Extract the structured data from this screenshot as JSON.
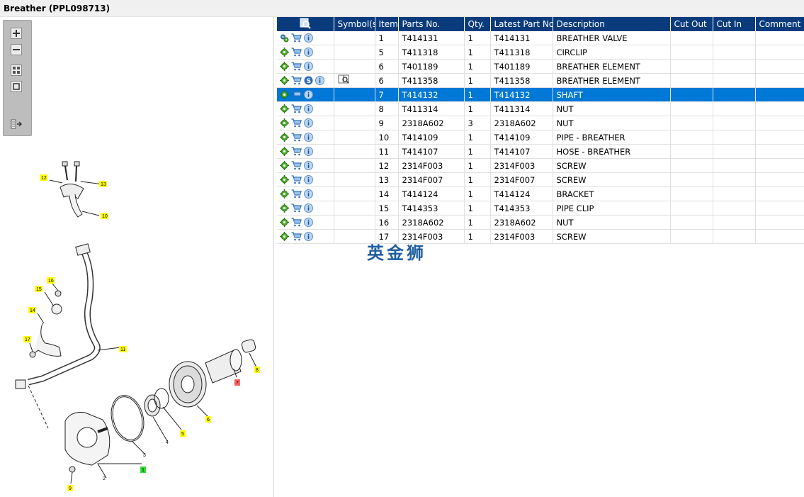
{
  "title": "Breather (PPL098713)",
  "colors": {
    "header_bg": "#0a3c7d",
    "selected_row": "#0078d7",
    "callout_yellow": "#ffff00",
    "callout_red": "#ff6060",
    "callout_green": "#33dd33"
  },
  "toolbar": {
    "buttons": [
      {
        "name": "zoom-in",
        "icon": "plus-icon"
      },
      {
        "name": "zoom-out",
        "icon": "minus-icon"
      },
      {
        "name": "fit",
        "icon": "fit-all-icon"
      },
      {
        "name": "actual-size",
        "icon": "square-icon"
      },
      {
        "name": "toggle-panel",
        "icon": "list-arrow-icon"
      }
    ]
  },
  "table": {
    "headers": {
      "search": "",
      "symbols": "Symbol(s)",
      "item": "Item",
      "parts_no": "Parts No.",
      "qty": "Qty.",
      "latest_part_no": "Latest Part No.",
      "description": "Description",
      "cut_out": "Cut Out",
      "cut_in": "Cut In",
      "comment": "Comment"
    },
    "rows": [
      {
        "item": "1",
        "parts_no": "T414131",
        "qty": "1",
        "latest": "T414131",
        "description": "BREATHER VALVE",
        "cut_out": "",
        "cut_in": "",
        "comment": "",
        "icons": [
          "gears-icon",
          "cart-icon",
          "info-icon"
        ],
        "symbol": ""
      },
      {
        "item": "5",
        "parts_no": "T411318",
        "qty": "1",
        "latest": "T411318",
        "description": "CIRCLIP",
        "cut_out": "",
        "cut_in": "",
        "comment": "",
        "icons": [
          "gear-icon",
          "cart-icon",
          "info-icon"
        ],
        "symbol": ""
      },
      {
        "item": "6",
        "parts_no": "T401189",
        "qty": "1",
        "latest": "T401189",
        "description": "BREATHER ELEMENT",
        "cut_out": "",
        "cut_in": "",
        "comment": "",
        "icons": [
          "gear-icon",
          "cart-icon",
          "info-icon"
        ],
        "symbol": ""
      },
      {
        "item": "6",
        "parts_no": "T411358",
        "qty": "1",
        "latest": "T411358",
        "description": "BREATHER ELEMENT",
        "cut_out": "",
        "cut_in": "",
        "comment": "",
        "icons": [
          "gear-icon",
          "cart-icon",
          "s-icon",
          "info-icon"
        ],
        "symbol": "book-search-icon"
      },
      {
        "item": "7",
        "parts_no": "T414132",
        "qty": "1",
        "latest": "T414132",
        "description": "SHAFT",
        "cut_out": "",
        "cut_in": "",
        "comment": "",
        "icons": [
          "gear-icon",
          "cart-icon",
          "info-icon"
        ],
        "symbol": "",
        "selected": true
      },
      {
        "item": "8",
        "parts_no": "T411314",
        "qty": "1",
        "latest": "T411314",
        "description": "NUT",
        "cut_out": "",
        "cut_in": "",
        "comment": "",
        "icons": [
          "gear-icon",
          "cart-icon",
          "info-icon"
        ],
        "symbol": ""
      },
      {
        "item": "9",
        "parts_no": "2318A602",
        "qty": "3",
        "latest": "2318A602",
        "description": "NUT",
        "cut_out": "",
        "cut_in": "",
        "comment": "",
        "icons": [
          "gear-icon",
          "cart-icon",
          "info-icon"
        ],
        "symbol": ""
      },
      {
        "item": "10",
        "parts_no": "T414109",
        "qty": "1",
        "latest": "T414109",
        "description": "PIPE - BREATHER",
        "cut_out": "",
        "cut_in": "",
        "comment": "",
        "icons": [
          "gear-icon",
          "cart-icon",
          "info-icon"
        ],
        "symbol": ""
      },
      {
        "item": "11",
        "parts_no": "T414107",
        "qty": "1",
        "latest": "T414107",
        "description": "HOSE - BREATHER",
        "cut_out": "",
        "cut_in": "",
        "comment": "",
        "icons": [
          "gear-icon",
          "cart-icon",
          "info-icon"
        ],
        "symbol": ""
      },
      {
        "item": "12",
        "parts_no": "2314F003",
        "qty": "1",
        "latest": "2314F003",
        "description": "SCREW",
        "cut_out": "",
        "cut_in": "",
        "comment": "",
        "icons": [
          "gear-icon",
          "cart-icon",
          "info-icon"
        ],
        "symbol": ""
      },
      {
        "item": "13",
        "parts_no": "2314F007",
        "qty": "1",
        "latest": "2314F007",
        "description": "SCREW",
        "cut_out": "",
        "cut_in": "",
        "comment": "",
        "icons": [
          "gear-icon",
          "cart-icon",
          "info-icon"
        ],
        "symbol": ""
      },
      {
        "item": "14",
        "parts_no": "T414124",
        "qty": "1",
        "latest": "T414124",
        "description": "BRACKET",
        "cut_out": "",
        "cut_in": "",
        "comment": "",
        "icons": [
          "gear-icon",
          "cart-icon",
          "info-icon"
        ],
        "symbol": ""
      },
      {
        "item": "15",
        "parts_no": "T414353",
        "qty": "1",
        "latest": "T414353",
        "description": "PIPE CLIP",
        "cut_out": "",
        "cut_in": "",
        "comment": "",
        "icons": [
          "gear-icon",
          "cart-icon",
          "info-icon"
        ],
        "symbol": ""
      },
      {
        "item": "16",
        "parts_no": "2318A602",
        "qty": "1",
        "latest": "2318A602",
        "description": "NUT",
        "cut_out": "",
        "cut_in": "",
        "comment": "",
        "icons": [
          "gear-icon",
          "cart-icon",
          "info-icon"
        ],
        "symbol": ""
      },
      {
        "item": "17",
        "parts_no": "2314F003",
        "qty": "1",
        "latest": "2314F003",
        "description": "SCREW",
        "cut_out": "",
        "cut_in": "",
        "comment": "",
        "icons": [
          "gear-icon",
          "cart-icon",
          "info-icon"
        ],
        "symbol": ""
      }
    ]
  },
  "watermark": "英金狮",
  "diagram": {
    "callouts": [
      {
        "label": "12",
        "color": "yellow"
      },
      {
        "label": "13",
        "color": "yellow"
      },
      {
        "label": "10",
        "color": "yellow"
      },
      {
        "label": "16",
        "color": "yellow"
      },
      {
        "label": "15",
        "color": "yellow"
      },
      {
        "label": "14",
        "color": "yellow"
      },
      {
        "label": "17",
        "color": "yellow"
      },
      {
        "label": "11",
        "color": "yellow"
      },
      {
        "label": "8",
        "color": "yellow"
      },
      {
        "label": "7",
        "color": "red"
      },
      {
        "label": "6",
        "color": "yellow"
      },
      {
        "label": "5",
        "color": "yellow"
      },
      {
        "label": "4",
        "color": "none"
      },
      {
        "label": "3",
        "color": "none"
      },
      {
        "label": "1",
        "color": "green"
      },
      {
        "label": "2",
        "color": "none"
      },
      {
        "label": "9",
        "color": "yellow"
      }
    ]
  }
}
